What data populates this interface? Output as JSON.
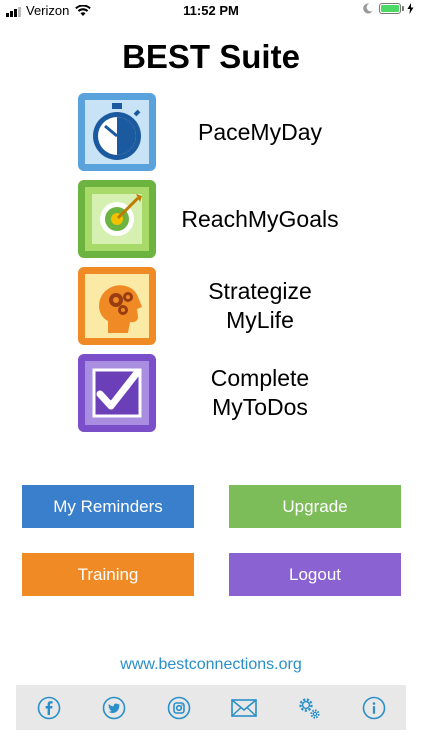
{
  "status_bar": {
    "carrier": "Verizon",
    "time": "11:52 PM"
  },
  "title": "BEST Suite",
  "apps": [
    {
      "label": "PaceMyDay",
      "icon": "stopwatch-icon"
    },
    {
      "label": "ReachMyGoals",
      "icon": "target-icon"
    },
    {
      "label": "Strategize\nMyLife",
      "icon": "head-gears-icon"
    },
    {
      "label": "Complete\nMyToDos",
      "icon": "checkbox-icon"
    }
  ],
  "buttons": {
    "reminders": "My Reminders",
    "upgrade": "Upgrade",
    "training": "Training",
    "logout": "Logout"
  },
  "website": "www.bestconnections.org",
  "colors": {
    "blue": "#3a7fcb",
    "green": "#7cbd5a",
    "orange": "#ef8a24",
    "purple": "#8a62d2",
    "link": "#2a8fc9"
  },
  "bottom_icons": [
    "facebook-icon",
    "twitter-icon",
    "instagram-icon",
    "mail-icon",
    "settings-icon",
    "info-icon"
  ]
}
